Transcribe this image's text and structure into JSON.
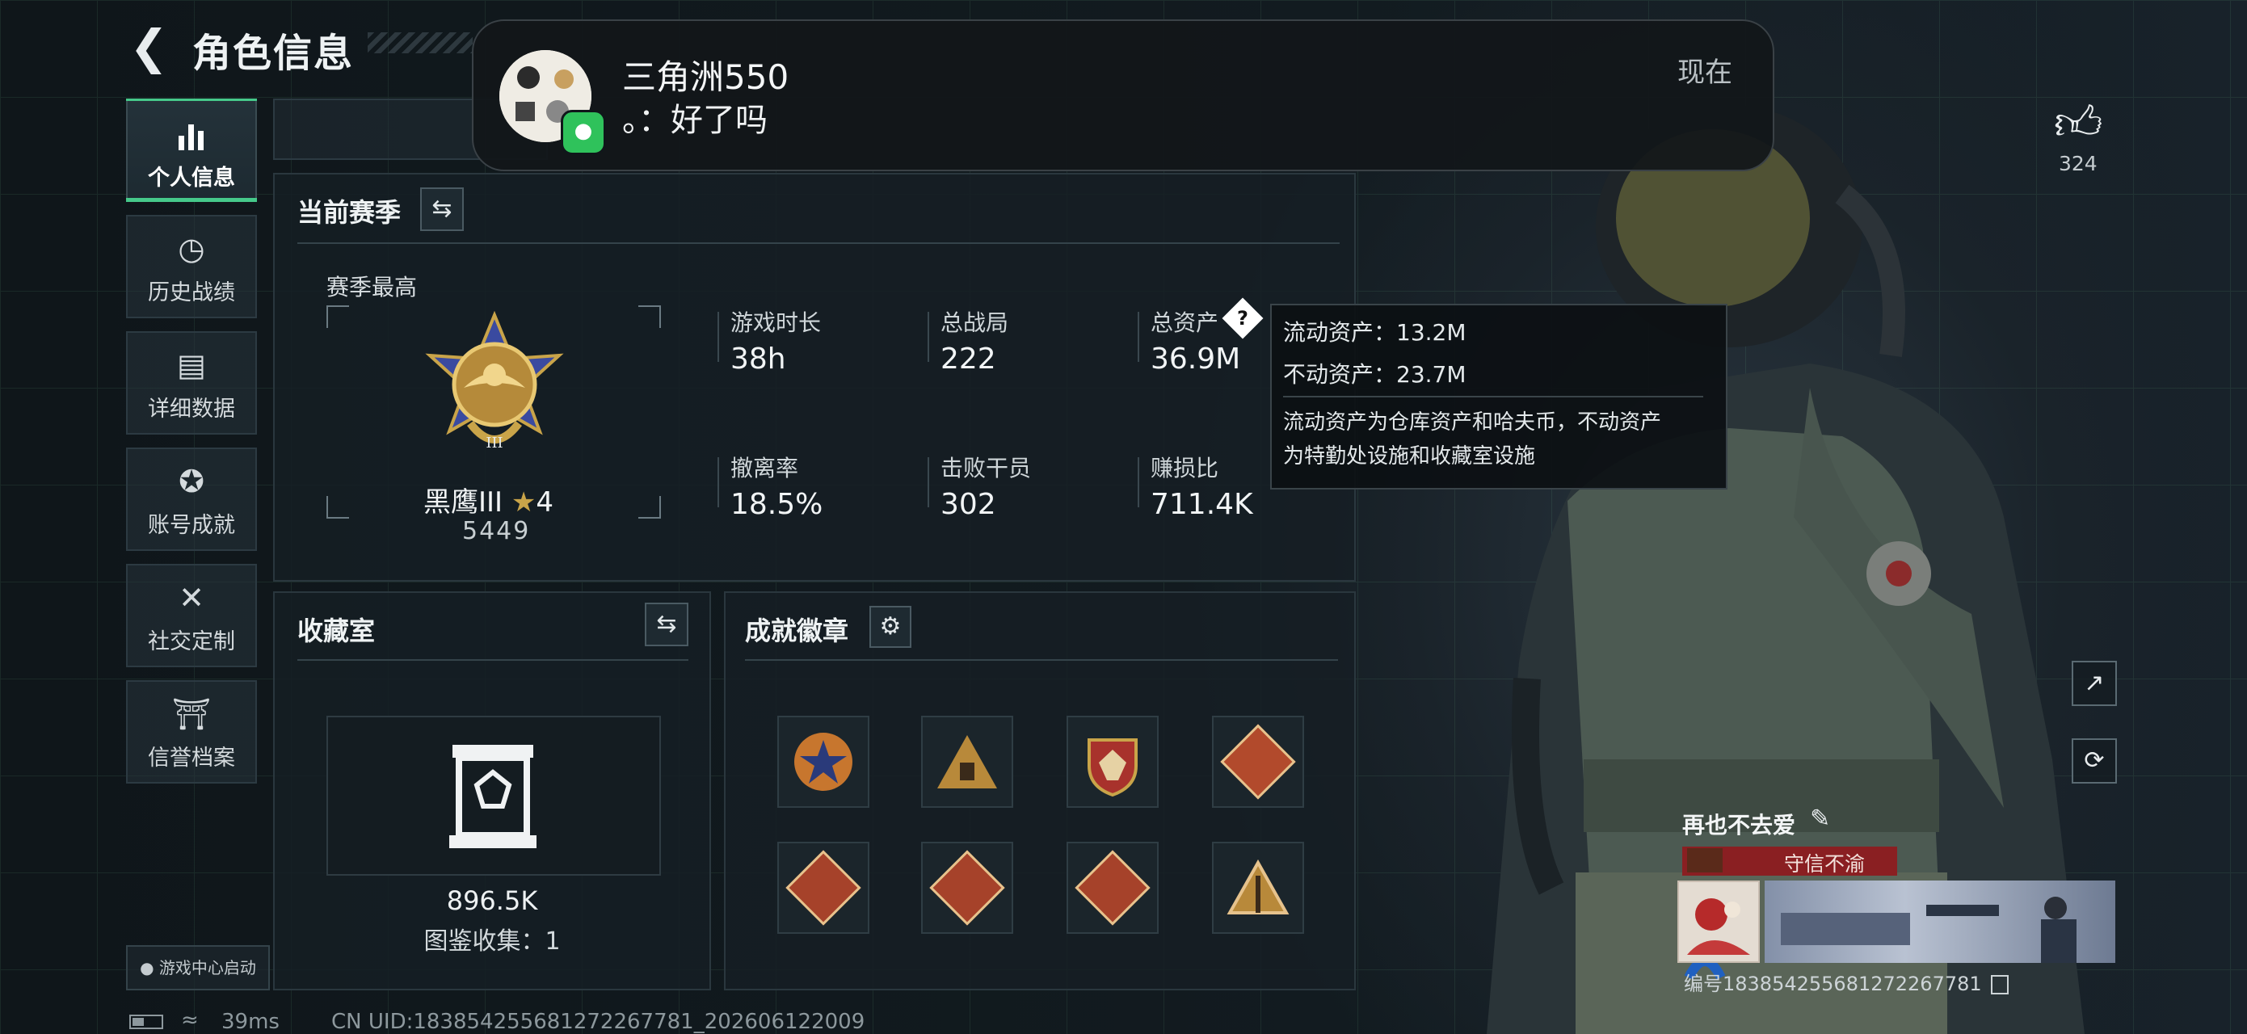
{
  "header": {
    "back_icon": "chevron-left-icon",
    "title": "角色信息"
  },
  "sidebar": {
    "items": [
      {
        "label": "个人信息",
        "icon": "bar-chart-icon",
        "glyph": "▮",
        "active": true
      },
      {
        "label": "历史战绩",
        "icon": "clock-icon",
        "glyph": "◷"
      },
      {
        "label": "详细数据",
        "icon": "folder-icon",
        "glyph": "▤"
      },
      {
        "label": "账号成就",
        "icon": "achievement-icon",
        "glyph": "✪"
      },
      {
        "label": "社交定制",
        "icon": "tools-icon",
        "glyph": "✕"
      },
      {
        "label": "信誉档案",
        "icon": "shield-icon",
        "glyph": "⛉"
      }
    ],
    "game_center": "游戏中心启动"
  },
  "season": {
    "title": "当前赛季",
    "best_label": "赛季最高",
    "rank_name": "黑鹰III",
    "rank_stars": "4",
    "rank_score": "5449",
    "stats": [
      {
        "label": "游戏时长",
        "value": "38h"
      },
      {
        "label": "总战局",
        "value": "222"
      },
      {
        "label": "总资产",
        "value": "36.9M"
      },
      {
        "label": "撤离率",
        "value": "18.5%"
      },
      {
        "label": "击败干员",
        "value": "302"
      },
      {
        "label": "赚损比",
        "value": "711.4K"
      }
    ]
  },
  "collection": {
    "title": "收藏室",
    "value": "896.5K",
    "catalog": "图鉴收集：1"
  },
  "achievements": {
    "title": "成就徽章",
    "badges": [
      {
        "name": "star-badge-icon",
        "color": "#c7762e"
      },
      {
        "name": "triangle-badge-icon",
        "color": "#b8893a"
      },
      {
        "name": "shield-badge-icon",
        "color": "#a8322c"
      },
      {
        "name": "runner-badge-icon",
        "color": "#b24a2c"
      },
      {
        "name": "dragon-badge-icon",
        "color": "#a6422a"
      },
      {
        "name": "dragon-badge-icon-2",
        "color": "#a6422a"
      },
      {
        "name": "wolf-badge-icon",
        "color": "#a6422a"
      },
      {
        "name": "pyramid-badge-icon",
        "color": "#b8893a"
      }
    ]
  },
  "notification": {
    "sender": "三角洲550",
    "message": "。：好了吗",
    "time": "现在"
  },
  "tooltip": {
    "liquid": "流动资产：13.2M",
    "fixed": "不动资产：23.7M",
    "desc_line1": "流动资产为仓库资产和哈夫币，不动资产",
    "desc_line2": "为特勤处设施和收藏室设施"
  },
  "likes": {
    "count": "324",
    "icon": "thumbs-up-icon"
  },
  "player": {
    "name": "再也不去爱",
    "title_badge": "守信不渝",
    "id_text": "编号1838542556812722677​81"
  },
  "status_bar": {
    "ping": "39ms",
    "uid": "CN UID:1838542556812722677​81_202606122009"
  },
  "colors": {
    "accent": "#46c98a",
    "title_badge": "#8a1f22",
    "gold": "#c9a449"
  }
}
